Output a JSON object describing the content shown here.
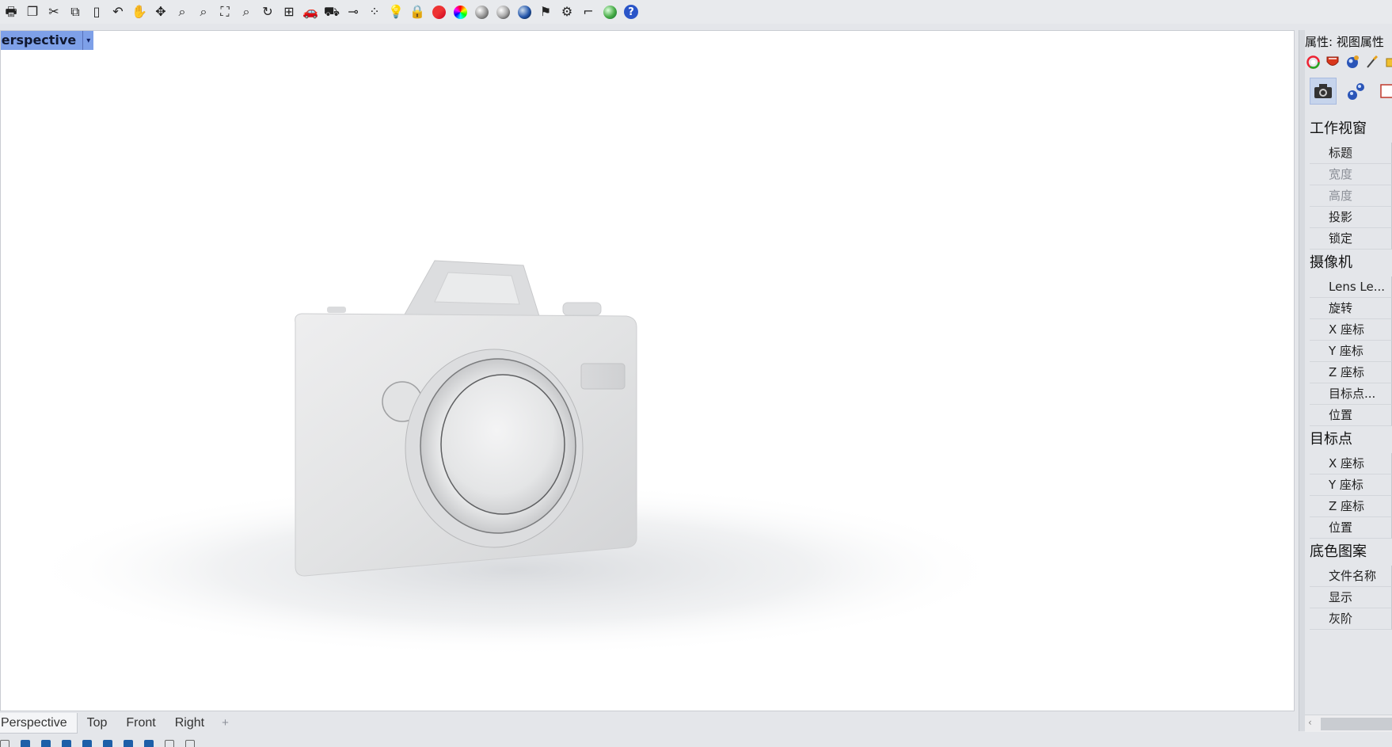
{
  "toolbar": {
    "icons": [
      "print-icon",
      "new-file-icon",
      "cut-icon",
      "copy-icon",
      "paste-icon",
      "undo-icon",
      "pan-hand-icon",
      "move-view-icon",
      "zoom-icon",
      "zoom-window-icon",
      "zoom-extents-icon",
      "zoom-selected-icon",
      "rotate-view-icon",
      "four-viewports-icon",
      "car-icon",
      "car-gray-icon",
      "snap-icon",
      "points-icon",
      "light-icon",
      "lock-icon",
      "layer-icon",
      "color-wheel-icon",
      "shaded-sphere-icon",
      "rendered-sphere-icon",
      "blue-sphere-icon",
      "flag-icon",
      "gear-icon",
      "dimension-icon",
      "globe-icon",
      "help-icon"
    ]
  },
  "viewport": {
    "title": "Perspective",
    "dropdown_caret": "▾"
  },
  "tabs": {
    "items": [
      "Perspective",
      "Top",
      "Front",
      "Right"
    ],
    "active": "Perspective",
    "add": "+"
  },
  "panel": {
    "title": "属性: 视图属性",
    "sections": [
      {
        "head": "工作视窗",
        "rows": [
          {
            "label": "标题",
            "disabled": false
          },
          {
            "label": "宽度",
            "disabled": true
          },
          {
            "label": "高度",
            "disabled": true
          },
          {
            "label": "投影",
            "disabled": false
          },
          {
            "label": "锁定",
            "disabled": false
          }
        ]
      },
      {
        "head": "摄像机",
        "rows": [
          {
            "label": "Lens Le...",
            "disabled": false
          },
          {
            "label": "旋转",
            "disabled": false
          },
          {
            "label": "X 座标",
            "disabled": false
          },
          {
            "label": "Y 座标",
            "disabled": false
          },
          {
            "label": "Z 座标",
            "disabled": false
          },
          {
            "label": "目标点...",
            "disabled": false
          },
          {
            "label": "位置",
            "disabled": false
          }
        ]
      },
      {
        "head": "目标点",
        "rows": [
          {
            "label": "X 座标",
            "disabled": false
          },
          {
            "label": "Y 座标",
            "disabled": false
          },
          {
            "label": "Z 座标",
            "disabled": false
          },
          {
            "label": "位置",
            "disabled": false
          }
        ]
      },
      {
        "head": "底色图案",
        "rows": [
          {
            "label": "文件名称",
            "disabled": false
          },
          {
            "label": "显示",
            "disabled": false
          },
          {
            "label": "灰阶",
            "disabled": false
          }
        ]
      }
    ]
  },
  "colors": {
    "viewport_title_bg": "#7ea0e8",
    "checkbox_blue": "#1d5fa8"
  }
}
